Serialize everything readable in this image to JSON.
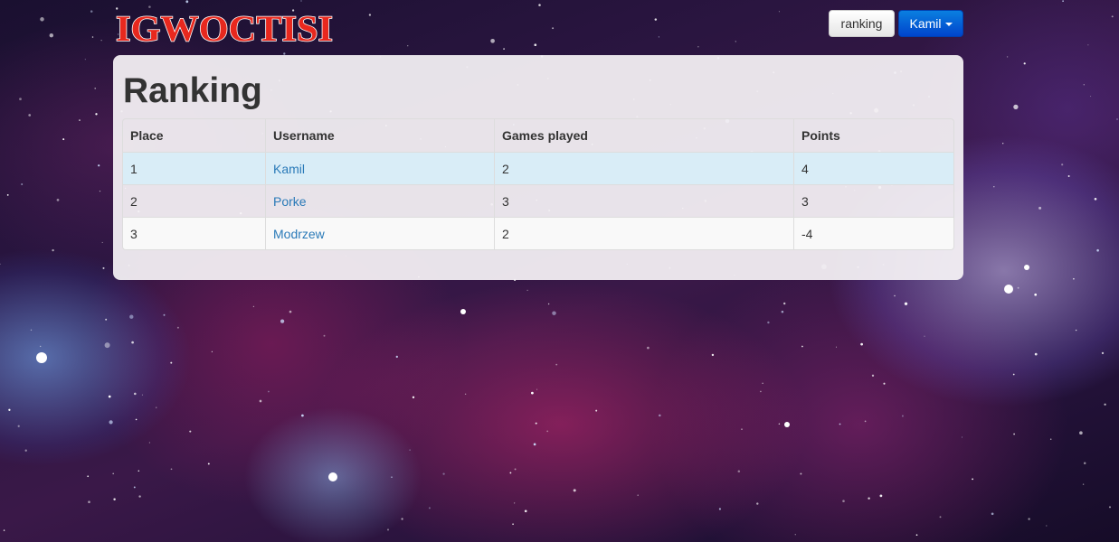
{
  "header": {
    "logo_text": "IGWOCTISI",
    "ranking_button": "ranking",
    "user_button": "Kamil"
  },
  "page": {
    "title": "Ranking"
  },
  "table": {
    "columns": [
      "Place",
      "Username",
      "Games played",
      "Points"
    ],
    "rows": [
      {
        "place": "1",
        "username": "Kamil",
        "games_played": "2",
        "points": "4"
      },
      {
        "place": "2",
        "username": "Porke",
        "games_played": "3",
        "points": "3"
      },
      {
        "place": "3",
        "username": "Modrzew",
        "games_played": "2",
        "points": "-4"
      }
    ]
  },
  "colors": {
    "link": "#2a7ab8",
    "highlight_row": "#d9edf7",
    "primary_button": "#0066dd",
    "logo_red": "#e8281e"
  }
}
